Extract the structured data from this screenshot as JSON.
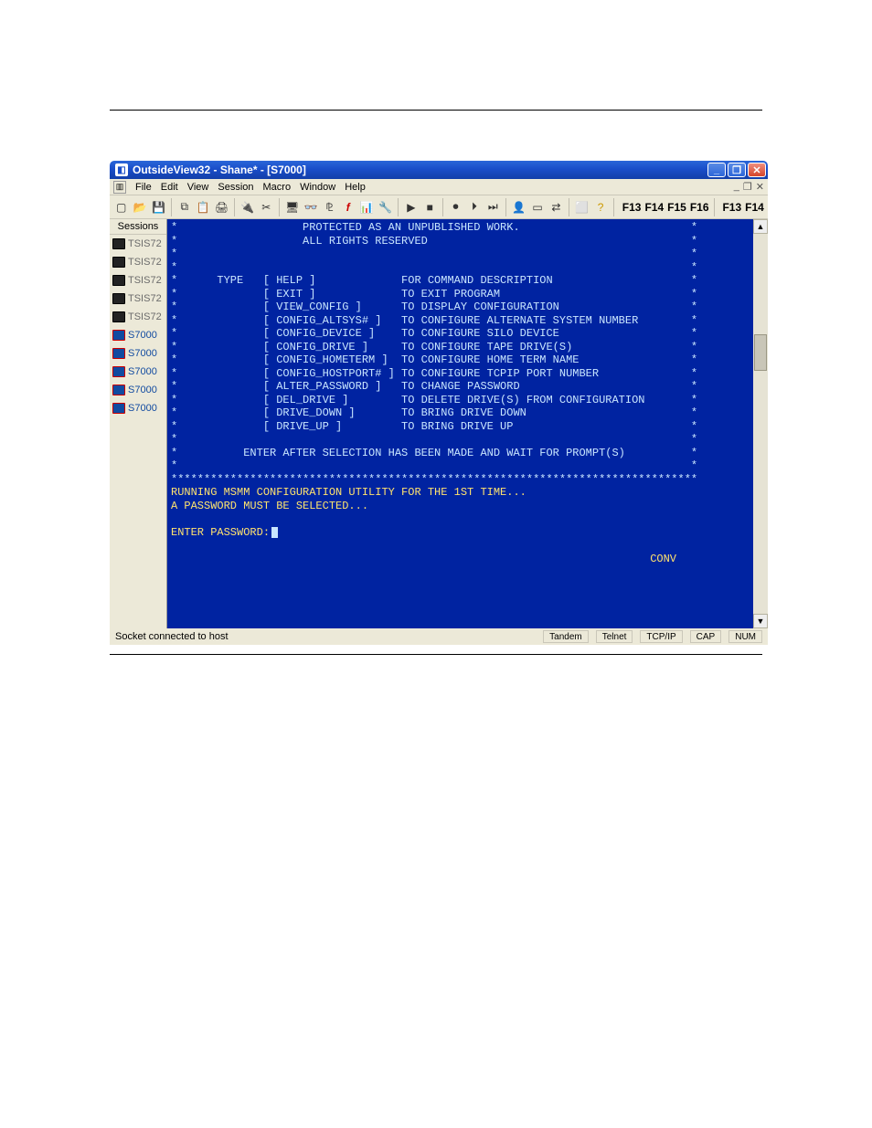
{
  "window": {
    "title": "OutsideView32 - Shane* - [S7000]"
  },
  "menubar": [
    "File",
    "Edit",
    "View",
    "Session",
    "Macro",
    "Window",
    "Help"
  ],
  "fkeys_right": [
    "F13",
    "F14",
    "F15",
    "F16"
  ],
  "fkeys_far": [
    "F13",
    "F14"
  ],
  "sessions_header": "Sessions",
  "sessions": [
    {
      "label": "TSIS72",
      "active": false
    },
    {
      "label": "TSIS72",
      "active": false
    },
    {
      "label": "TSIS72",
      "active": false
    },
    {
      "label": "TSIS72",
      "active": false
    },
    {
      "label": "TSIS72",
      "active": false
    },
    {
      "label": "S7000",
      "active": true
    },
    {
      "label": "S7000",
      "active": true
    },
    {
      "label": "S7000",
      "active": true
    },
    {
      "label": "S7000",
      "active": true
    },
    {
      "label": "S7000",
      "active": true
    }
  ],
  "terminal": {
    "header_lines": [
      "*                   PROTECTED AS AN UNPUBLISHED WORK.                          *",
      "*                   ALL RIGHTS RESERVED                                        *",
      "*                                                                              *",
      "*                                                                              *"
    ],
    "type_label": "TYPE",
    "commands": [
      {
        "cmd": "[ HELP ]",
        "desc": "FOR COMMAND DESCRIPTION"
      },
      {
        "cmd": "[ EXIT ]",
        "desc": "TO EXIT PROGRAM"
      },
      {
        "cmd": "[ VIEW_CONFIG ]",
        "desc": "TO DISPLAY CONFIGURATION"
      },
      {
        "cmd": "[ CONFIG_ALTSYS# ]",
        "desc": "TO CONFIGURE ALTERNATE SYSTEM NUMBER"
      },
      {
        "cmd": "[ CONFIG_DEVICE ]",
        "desc": "TO CONFIGURE SILO DEVICE"
      },
      {
        "cmd": "[ CONFIG_DRIVE ]",
        "desc": "TO CONFIGURE TAPE DRIVE(S)"
      },
      {
        "cmd": "[ CONFIG_HOMETERM ]",
        "desc": "TO CONFIGURE HOME TERM NAME"
      },
      {
        "cmd": "[ CONFIG_HOSTPORT# ]",
        "desc": "TO CONFIGURE TCPIP PORT NUMBER"
      },
      {
        "cmd": "[ ALTER_PASSWORD ]",
        "desc": "TO CHANGE PASSWORD"
      },
      {
        "cmd": "[ DEL_DRIVE ]",
        "desc": "TO DELETE DRIVE(S) FROM CONFIGURATION"
      },
      {
        "cmd": "[ DRIVE_DOWN ]",
        "desc": "TO BRING DRIVE DOWN"
      },
      {
        "cmd": "[ DRIVE_UP ]",
        "desc": "TO BRING DRIVE UP"
      }
    ],
    "footer_prompt": "*          ENTER AFTER SELECTION HAS BEEN MADE AND WAIT FOR PROMPT(S)          *",
    "star_row": "********************************************************************************",
    "run_lines": [
      "RUNNING MSMM CONFIGURATION UTILITY FOR THE 1ST TIME...",
      "A PASSWORD MUST BE SELECTED...",
      "",
      "ENTER PASSWORD:"
    ]
  },
  "status_conv": "CONV",
  "statusbar": {
    "conn": "Socket connected to host",
    "cells": [
      "Tandem",
      "Telnet",
      "TCP/IP",
      "CAP",
      "NUM"
    ]
  }
}
